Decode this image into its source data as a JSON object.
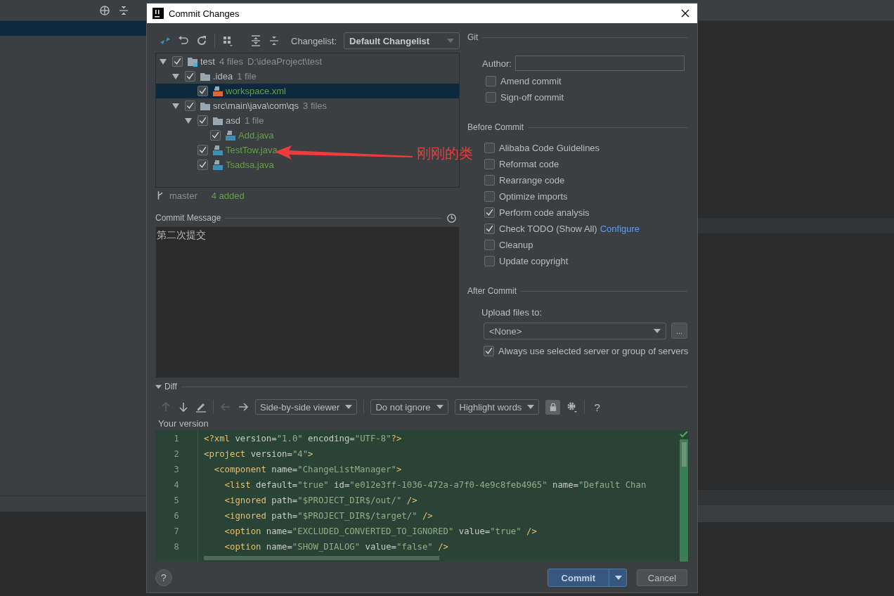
{
  "dialog": {
    "title": "Commit Changes"
  },
  "changes": {
    "changelist_label": "Changelist:",
    "changelist": "Default Changelist",
    "tree": [
      {
        "kind": "module",
        "name": "test",
        "count": "4 files",
        "path": "D:\\ideaProject\\test",
        "checked": true,
        "expanded": true,
        "selected": false,
        "children": [
          {
            "kind": "folder",
            "name": ".idea",
            "count": "1 file",
            "checked": true,
            "expanded": true,
            "selected": false,
            "children": [
              {
                "kind": "xml",
                "name": "workspace.xml",
                "checked": true,
                "selected": true
              }
            ]
          },
          {
            "kind": "folder",
            "name": "src\\main\\java\\com\\qs",
            "count": "3 files",
            "checked": true,
            "expanded": true,
            "selected": false,
            "children": [
              {
                "kind": "folder",
                "name": "asd",
                "count": "1 file",
                "checked": true,
                "expanded": true,
                "selected": false,
                "children": [
                  {
                    "kind": "java",
                    "name": "Add.java",
                    "checked": true,
                    "selected": false
                  }
                ]
              },
              {
                "kind": "java",
                "name": "TestTow.java",
                "checked": true,
                "selected": false
              },
              {
                "kind": "java",
                "name": "Tsadsa.java",
                "checked": true,
                "selected": false
              }
            ]
          }
        ]
      }
    ],
    "branch": "master",
    "summary": "4 added"
  },
  "commit_message": {
    "label": "Commit Message",
    "value": "第二次提交"
  },
  "annotation": {
    "text": "刚刚的类"
  },
  "git": {
    "title": "Git",
    "author_label": "Author:",
    "options": [
      {
        "label": "Amend commit",
        "checked": false
      },
      {
        "label": "Sign-off commit",
        "checked": false
      }
    ]
  },
  "before_commit": {
    "title": "Before Commit",
    "options": [
      {
        "label": "Alibaba Code Guidelines",
        "checked": false
      },
      {
        "label": "Reformat code",
        "checked": false
      },
      {
        "label": "Rearrange code",
        "checked": false
      },
      {
        "label": "Optimize imports",
        "checked": false
      },
      {
        "label": "Perform code analysis",
        "checked": true
      },
      {
        "label": "Check TODO (Show All)",
        "checked": true,
        "link": "Configure"
      },
      {
        "label": "Cleanup",
        "checked": false
      },
      {
        "label": "Update copyright",
        "checked": false
      }
    ]
  },
  "after_commit": {
    "title": "After Commit",
    "upload_label": "Upload files to:",
    "server": "<None>",
    "more_button": "...",
    "options": [
      {
        "label": "Always use selected server or group of servers",
        "checked": true
      }
    ]
  },
  "diff": {
    "title": "Diff",
    "expanded": true,
    "viewer": "Side-by-side viewer",
    "ignore": "Do not ignore",
    "highlight": "Highlight words",
    "locked": true,
    "help": "?",
    "version_label": "Your version",
    "lines": [
      {
        "number": "1",
        "tokens": [
          {
            "kind": "tag",
            "text": "<?xml"
          },
          {
            "kind": "attr",
            "text": " version="
          },
          {
            "kind": "value",
            "text": "\"1.0\""
          },
          {
            "kind": "attr",
            "text": " encoding="
          },
          {
            "kind": "value",
            "text": "\"UTF-8\""
          },
          {
            "kind": "tag",
            "text": "?>"
          }
        ]
      },
      {
        "number": "2",
        "tokens": [
          {
            "kind": "tag",
            "text": "<project"
          },
          {
            "kind": "attr",
            "text": " version="
          },
          {
            "kind": "value",
            "text": "\"4\""
          },
          {
            "kind": "tag",
            "text": ">"
          }
        ]
      },
      {
        "number": "3",
        "tokens": [
          {
            "kind": "tag",
            "text": "  <component"
          },
          {
            "kind": "attr",
            "text": " name="
          },
          {
            "kind": "value",
            "text": "\"ChangeListManager\""
          },
          {
            "kind": "tag",
            "text": ">"
          }
        ]
      },
      {
        "number": "4",
        "tokens": [
          {
            "kind": "tag",
            "text": "    <list"
          },
          {
            "kind": "attr",
            "text": " default="
          },
          {
            "kind": "value",
            "text": "\"true\""
          },
          {
            "kind": "attr",
            "text": " id="
          },
          {
            "kind": "value",
            "text": "\"e012e3ff-1036-472a-a7f0-4e9c8feb4965\""
          },
          {
            "kind": "attr",
            "text": " name="
          },
          {
            "kind": "value",
            "text": "\"Default Chan"
          }
        ]
      },
      {
        "number": "5",
        "tokens": [
          {
            "kind": "tag",
            "text": "    <ignored"
          },
          {
            "kind": "attr",
            "text": " path="
          },
          {
            "kind": "value",
            "text": "\"$PROJECT_DIR$/out/\""
          },
          {
            "kind": "tag",
            "text": " />"
          }
        ]
      },
      {
        "number": "6",
        "tokens": [
          {
            "kind": "tag",
            "text": "    <ignored"
          },
          {
            "kind": "attr",
            "text": " path="
          },
          {
            "kind": "value",
            "text": "\"$PROJECT_DIR$/target/\""
          },
          {
            "kind": "tag",
            "text": " />"
          }
        ]
      },
      {
        "number": "7",
        "tokens": [
          {
            "kind": "tag",
            "text": "    <option"
          },
          {
            "kind": "attr",
            "text": " name="
          },
          {
            "kind": "value",
            "text": "\"EXCLUDED_CONVERTED_TO_IGNORED\""
          },
          {
            "kind": "attr",
            "text": " value="
          },
          {
            "kind": "value",
            "text": "\"true\""
          },
          {
            "kind": "tag",
            "text": " />"
          }
        ]
      },
      {
        "number": "8",
        "tokens": [
          {
            "kind": "tag",
            "text": "    <option"
          },
          {
            "kind": "attr",
            "text": " name="
          },
          {
            "kind": "value",
            "text": "\"SHOW_DIALOG\""
          },
          {
            "kind": "attr",
            "text": " value="
          },
          {
            "kind": "value",
            "text": "\"false\""
          },
          {
            "kind": "tag",
            "text": " />"
          }
        ]
      }
    ]
  },
  "footer": {
    "help": "?",
    "commit": "Commit",
    "cancel": "Cancel"
  }
}
